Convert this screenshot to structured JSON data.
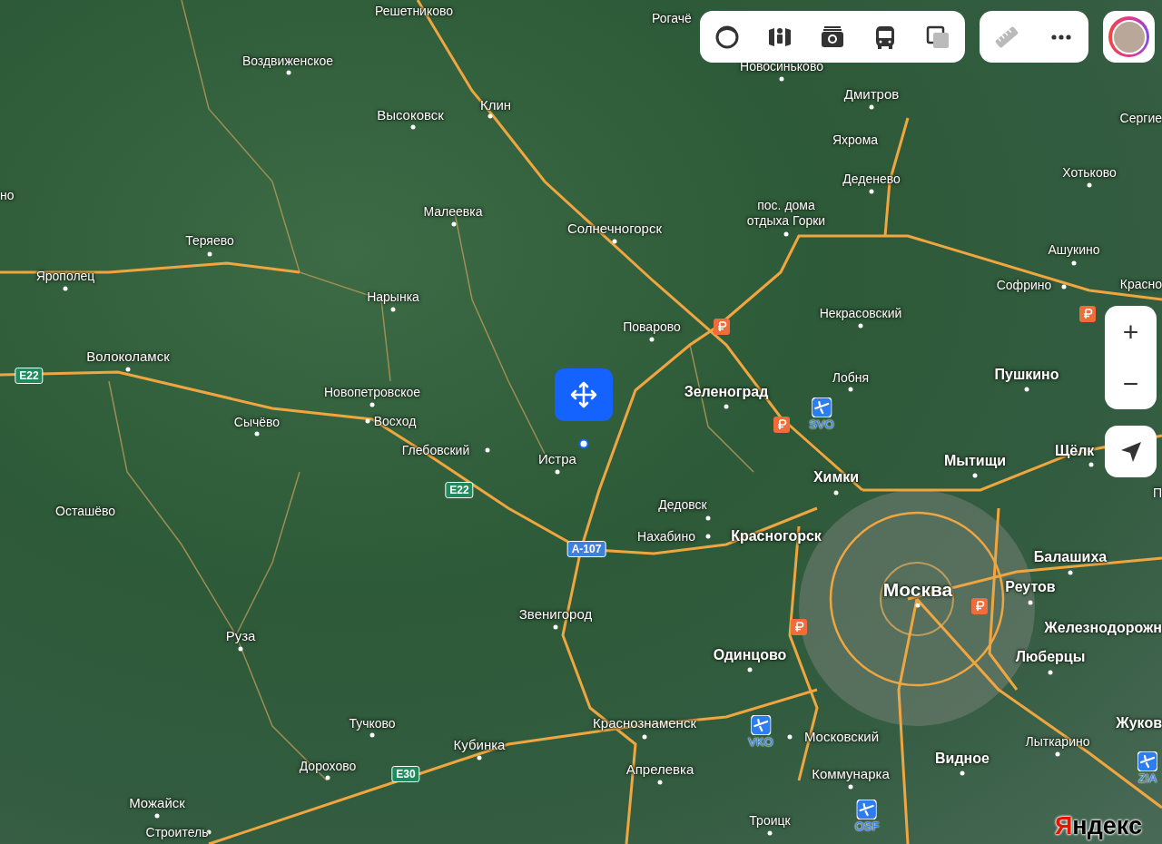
{
  "map": {
    "places": [
      {
        "name": "Решетниково",
        "kind": "town"
      },
      {
        "name": "Рогачё",
        "kind": "town"
      },
      {
        "name": "Воздвиженское",
        "kind": "town"
      },
      {
        "name": "Высоковск",
        "kind": "city"
      },
      {
        "name": "Клин",
        "kind": "city"
      },
      {
        "name": "Новосиньково",
        "kind": "town"
      },
      {
        "name": "Дмитров",
        "kind": "city"
      },
      {
        "name": "Яхрома",
        "kind": "town"
      },
      {
        "name": "Деденево",
        "kind": "town"
      },
      {
        "name": "Сергие",
        "kind": "town"
      },
      {
        "name": "Хотьково",
        "kind": "town"
      },
      {
        "name": "но",
        "kind": "town"
      },
      {
        "name": "Малеевка",
        "kind": "town"
      },
      {
        "name": "Солнечногорск",
        "kind": "city"
      },
      {
        "name": "пос. дома отдыха Горки",
        "kind": "town"
      },
      {
        "name": "Теряево",
        "kind": "town"
      },
      {
        "name": "Ярополец",
        "kind": "town"
      },
      {
        "name": "Ашукино",
        "kind": "town"
      },
      {
        "name": "Софрино",
        "kind": "town"
      },
      {
        "name": "Красно",
        "kind": "town"
      },
      {
        "name": "Нарынка",
        "kind": "town"
      },
      {
        "name": "Поварово",
        "kind": "town"
      },
      {
        "name": "Некрасовский",
        "kind": "town"
      },
      {
        "name": "Волоколамск",
        "kind": "city"
      },
      {
        "name": "Лобня",
        "kind": "town"
      },
      {
        "name": "Пушкино",
        "kind": "major"
      },
      {
        "name": "Зеленоград",
        "kind": "major"
      },
      {
        "name": "Новопетровское",
        "kind": "town"
      },
      {
        "name": "Сычёво",
        "kind": "town"
      },
      {
        "name": "Восход",
        "kind": "town"
      },
      {
        "name": "Глебовский",
        "kind": "town"
      },
      {
        "name": "Истра",
        "kind": "city"
      },
      {
        "name": "Химки",
        "kind": "major"
      },
      {
        "name": "Мытищи",
        "kind": "major"
      },
      {
        "name": "Щёлк",
        "kind": "major"
      },
      {
        "name": "П",
        "kind": "town"
      },
      {
        "name": "Дедовск",
        "kind": "town"
      },
      {
        "name": "Осташёво",
        "kind": "town"
      },
      {
        "name": "Нахабино",
        "kind": "town"
      },
      {
        "name": "Красногорск",
        "kind": "major"
      },
      {
        "name": "Балашиха",
        "kind": "major"
      },
      {
        "name": "Москва",
        "kind": "capital"
      },
      {
        "name": "Реутов",
        "kind": "major"
      },
      {
        "name": "Звенигород",
        "kind": "city"
      },
      {
        "name": "Железнодорожн",
        "kind": "major"
      },
      {
        "name": "Руза",
        "kind": "city"
      },
      {
        "name": "Одинцово",
        "kind": "major"
      },
      {
        "name": "Люберцы",
        "kind": "major"
      },
      {
        "name": "Тучково",
        "kind": "town"
      },
      {
        "name": "Краснознаменск",
        "kind": "city"
      },
      {
        "name": "Московский",
        "kind": "city"
      },
      {
        "name": "Жуков",
        "kind": "major"
      },
      {
        "name": "Кубинка",
        "kind": "city"
      },
      {
        "name": "Лыткарино",
        "kind": "town"
      },
      {
        "name": "Видное",
        "kind": "major"
      },
      {
        "name": "Дорохово",
        "kind": "town"
      },
      {
        "name": "Апрелевка",
        "kind": "city"
      },
      {
        "name": "Коммунарка",
        "kind": "city"
      },
      {
        "name": "Можайск",
        "kind": "city"
      },
      {
        "name": "Строитель",
        "kind": "town"
      },
      {
        "name": "Троицк",
        "kind": "town"
      }
    ],
    "road_shields": [
      {
        "label": "E22",
        "color": "#1f8a5c"
      },
      {
        "label": "E22",
        "color": "#1f8a5c"
      },
      {
        "label": "A-107",
        "color": "#3f7fe0"
      },
      {
        "label": "E30",
        "color": "#1f8a5c"
      }
    ],
    "airports": [
      {
        "code": "SVO"
      },
      {
        "code": "VKO"
      },
      {
        "code": "OSF"
      },
      {
        "code": "ZIA"
      }
    ]
  },
  "toolbar": {
    "ruler": {
      "disabled": true
    }
  },
  "zoom_controls": {
    "zoom_in": "+",
    "zoom_out": "−"
  },
  "logo": "Яндекс"
}
